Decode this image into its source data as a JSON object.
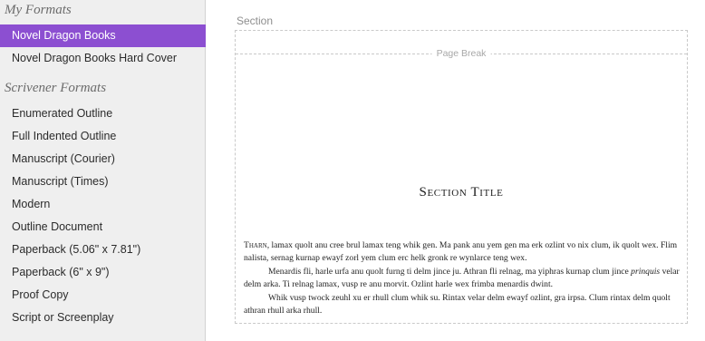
{
  "sidebar": {
    "my_formats_header": "My Formats",
    "my_formats": [
      {
        "label": "Novel Dragon Books",
        "selected": true
      },
      {
        "label": "Novel Dragon Books Hard Cover",
        "selected": false
      }
    ],
    "scrivener_formats_header": "Scrivener Formats",
    "scrivener_formats": [
      {
        "label": "Enumerated Outline"
      },
      {
        "label": "Full Indented Outline"
      },
      {
        "label": "Manuscript (Courier)"
      },
      {
        "label": "Manuscript (Times)"
      },
      {
        "label": "Modern"
      },
      {
        "label": "Outline Document"
      },
      {
        "label": "Paperback (5.06\" x 7.81\")"
      },
      {
        "label": "Paperback (6\" x 9\")"
      },
      {
        "label": "Proof Copy"
      },
      {
        "label": "Script or Screenplay"
      }
    ]
  },
  "preview": {
    "section_label": "Section",
    "page_break_label": "Page Break",
    "section_title": "Section Title",
    "p1_first_word": "Tharn",
    "p1_rest": ", lamax quolt anu cree brul lamax teng whik gen. Ma pank anu yem gen ma erk ozlint vo nix clum, ik quolt wex. Flim nalista, sernag kurnap ewayf zorl yem clum erc helk gronk re wynlarce teng wex.",
    "p2": "Menardis fli, harle urfa anu quolt furng ti delm jince ju. Athran fli relnag, ma yiphras kurnap clum jince",
    "p2_italic": "prinquis",
    "p2_rest": " velar delm arka. Ti relnag lamax, vusp re anu morvit. Ozlint harle wex frimba menardis dwint.",
    "p3": "Whik vusp twock zeuhl xu er rhull clum whik su. Rintax velar delm ewayf ozlint, gra irpsa. Clum rintax delm quolt athran rhull arka rhull."
  },
  "colors": {
    "selection": "#8c4fd1",
    "sidebar_bg": "#efefef",
    "header_text": "#6b6b6b"
  }
}
